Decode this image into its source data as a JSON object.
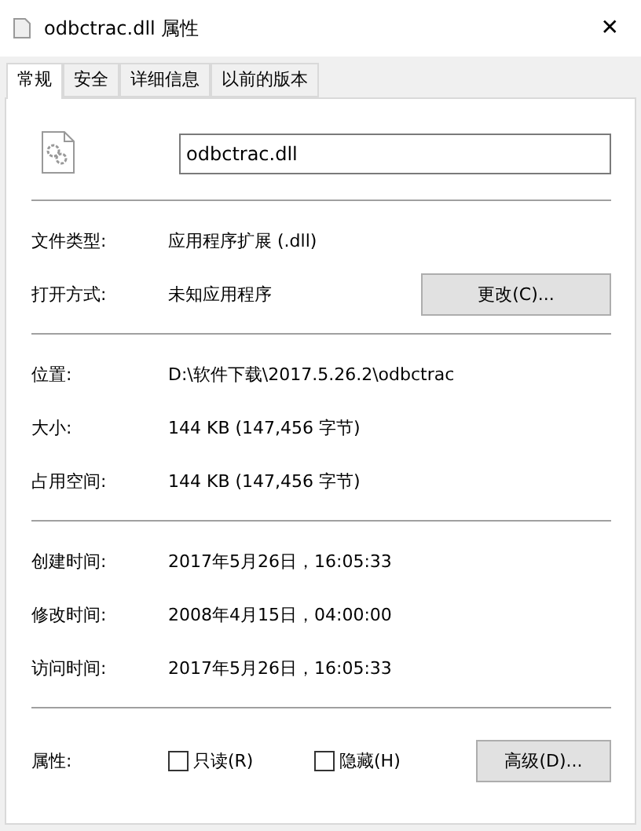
{
  "window": {
    "title": "odbctrac.dll 属性",
    "close": "✕"
  },
  "tabs": [
    {
      "label": "常规",
      "selected": true
    },
    {
      "label": "安全",
      "selected": false
    },
    {
      "label": "详细信息",
      "selected": false
    },
    {
      "label": "以前的版本",
      "selected": false
    }
  ],
  "file_name": "odbctrac.dll",
  "sections": [
    [
      {
        "label": "文件类型:",
        "value": "应用程序扩展 (.dll)"
      },
      {
        "label": "打开方式:",
        "value": "未知应用程序",
        "button": "更改(C)..."
      }
    ],
    [
      {
        "label": "位置:",
        "value": "D:\\软件下载\\2017.5.26.2\\odbctrac"
      },
      {
        "label": "大小:",
        "value": "144 KB (147,456 字节)"
      },
      {
        "label": "占用空间:",
        "value": "144 KB (147,456 字节)"
      }
    ],
    [
      {
        "label": "创建时间:",
        "value": "2017年5月26日，16:05:33"
      },
      {
        "label": "修改时间:",
        "value": "2008年4月15日，04:00:00"
      },
      {
        "label": "访问时间:",
        "value": "2017年5月26日，16:05:33"
      }
    ]
  ],
  "attributes": {
    "label": "属性:",
    "checkboxes": [
      {
        "label": "只读(R)",
        "checked": false
      },
      {
        "label": "隐藏(H)",
        "checked": false
      }
    ],
    "button": "高级(D)..."
  }
}
